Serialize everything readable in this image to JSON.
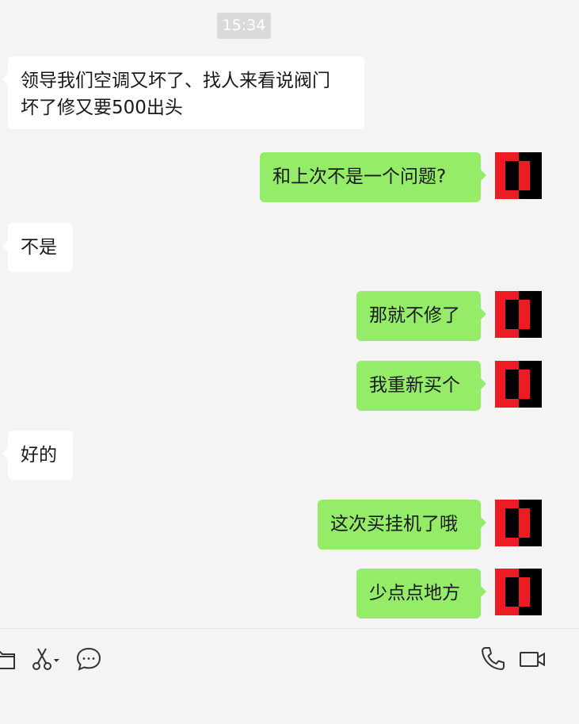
{
  "chat": {
    "timestamp": "15:34",
    "messages": [
      {
        "side": "in",
        "lines": [
          "领导我们空调又坏了、找人来看说阀门",
          "坏了修又要500出头"
        ]
      },
      {
        "side": "out",
        "text": "和上次不是一个问题?"
      },
      {
        "side": "in",
        "text": "不是"
      },
      {
        "side": "out",
        "text": "那就不修了"
      },
      {
        "side": "out",
        "text": "我重新买个"
      },
      {
        "side": "in",
        "text": "好的"
      },
      {
        "side": "out",
        "text": "这次买挂机了哦"
      },
      {
        "side": "out",
        "text": "少点点地方"
      }
    ]
  },
  "colors": {
    "background": "#f4f4f4",
    "incoming_bubble": "#ffffff",
    "outgoing_bubble": "#95ec69",
    "timestamp_bg": "#dadada",
    "avatar_red": "#ed1c24",
    "avatar_black": "#000000",
    "icon_stroke": "#333333"
  },
  "toolbar": {
    "icons": [
      "folder-icon",
      "scissors-icon",
      "chat-history-icon",
      "phone-icon",
      "video-call-icon"
    ]
  }
}
